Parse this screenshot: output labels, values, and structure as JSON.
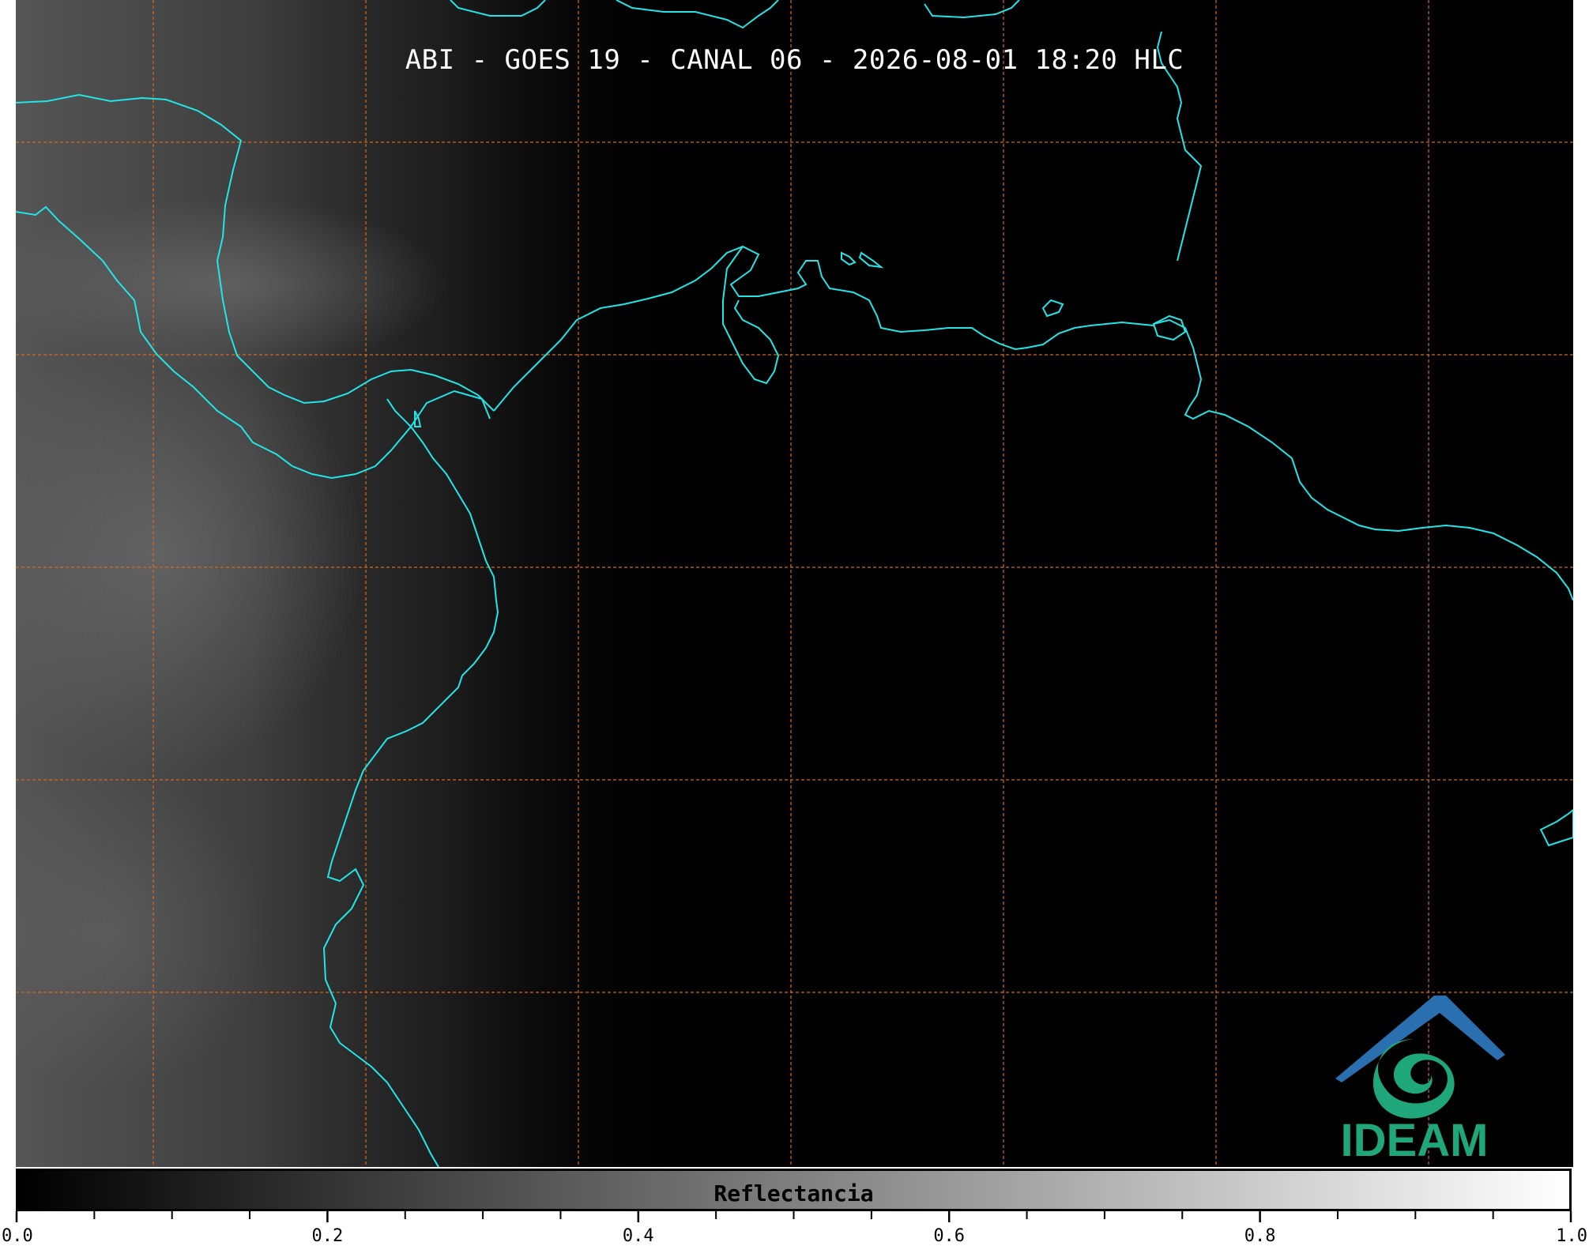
{
  "title": "ABI - GOES 19 - CANAL 06 - 2026-08-01 18:20 HLC",
  "colorbar": {
    "label": "Reflectancia",
    "major_ticks": [
      "0.0",
      "0.2",
      "0.4",
      "0.6",
      "0.8",
      "1.0"
    ],
    "range": [
      0.0,
      1.0
    ],
    "minor_tick_step": 0.05,
    "colormap": [
      "#000000",
      "#ffffff"
    ]
  },
  "logo": {
    "text": "IDEAM",
    "colors": {
      "roof": "#2a6fb0",
      "swirl": "#1fa67a",
      "text": "#1fa67a"
    }
  },
  "colors": {
    "coastline": "#22e5e8",
    "gridlines": "#d46a1c",
    "background": "#000000"
  },
  "map": {
    "gridlines": "dashed",
    "grid_columns": 7,
    "grid_rows": 5
  }
}
